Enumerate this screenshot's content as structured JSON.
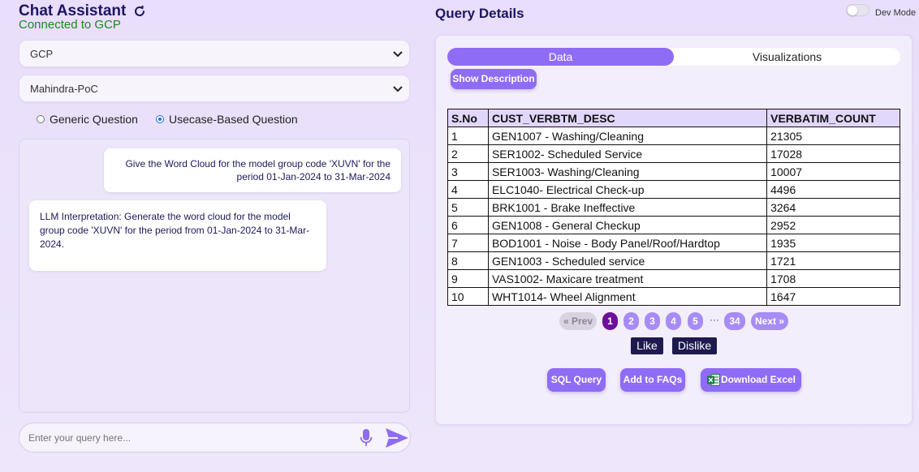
{
  "left": {
    "title": "Chat Assistant",
    "status": "Connected to GCP",
    "select1": "GCP",
    "select2": "Mahindra-PoC",
    "radio1": "Generic Question",
    "radio2": "Usecase-Based Question",
    "selected_radio": "Usecase-Based Question",
    "user_msg": "Give the Word Cloud for the model group code 'XUVN' for the period 01-Jan-2024 to 31-Mar-2024",
    "bot_msg": "LLM Interpretation: Generate the word cloud for the model group code 'XUVN' for the period from 01-Jan-2024 to 31-Mar-2024.",
    "input_placeholder": "Enter your query here..."
  },
  "right": {
    "title": "Query Details",
    "dev_mode": "Dev Mode",
    "dev_mode_on": false,
    "tab_data": "Data",
    "tab_viz": "Visualizations",
    "active_tab": "Data",
    "show_desc": "Show Description",
    "table": {
      "headers": [
        "S.No",
        "CUST_VERBTM_DESC",
        "VERBATIM_COUNT"
      ],
      "rows": [
        [
          "1",
          "GEN1007 - Washing/Cleaning",
          "21305"
        ],
        [
          "2",
          "SER1002- Scheduled Service",
          "17028"
        ],
        [
          "3",
          "SER1003- Washing/Cleaning",
          "10007"
        ],
        [
          "4",
          "ELC1040- Electrical Check-up",
          "4496"
        ],
        [
          "5",
          "BRK1001 - Brake Ineffective",
          "3264"
        ],
        [
          "6",
          "GEN1008 - General Checkup",
          "2952"
        ],
        [
          "7",
          "BOD1001 - Noise - Body Panel/Roof/Hardtop",
          "1935"
        ],
        [
          "8",
          "GEN1003 - Scheduled service",
          "1721"
        ],
        [
          "9",
          "VAS1002- Maxicare treatment",
          "1708"
        ],
        [
          "10",
          "WHT1014- Wheel Alignment",
          "1647"
        ]
      ]
    },
    "pager": {
      "prev": "« Prev",
      "pages": [
        "1",
        "2",
        "3",
        "4",
        "5"
      ],
      "dots": "···",
      "last": "34",
      "next": "Next »",
      "current": "1"
    },
    "like": "Like",
    "dislike": "Dislike",
    "sql": "SQL Query",
    "faq": "Add to FAQs",
    "excel": "Download Excel"
  },
  "colors": {
    "accent": "#8f6cf5",
    "title": "#1d1560",
    "status_green": "#1a8a1a",
    "active_page": "#6e0f9a",
    "dark_button": "#1e1a4f"
  },
  "icons": [
    "refresh-icon",
    "chevron-down-icon",
    "mic-icon",
    "send-icon",
    "excel-icon"
  ]
}
